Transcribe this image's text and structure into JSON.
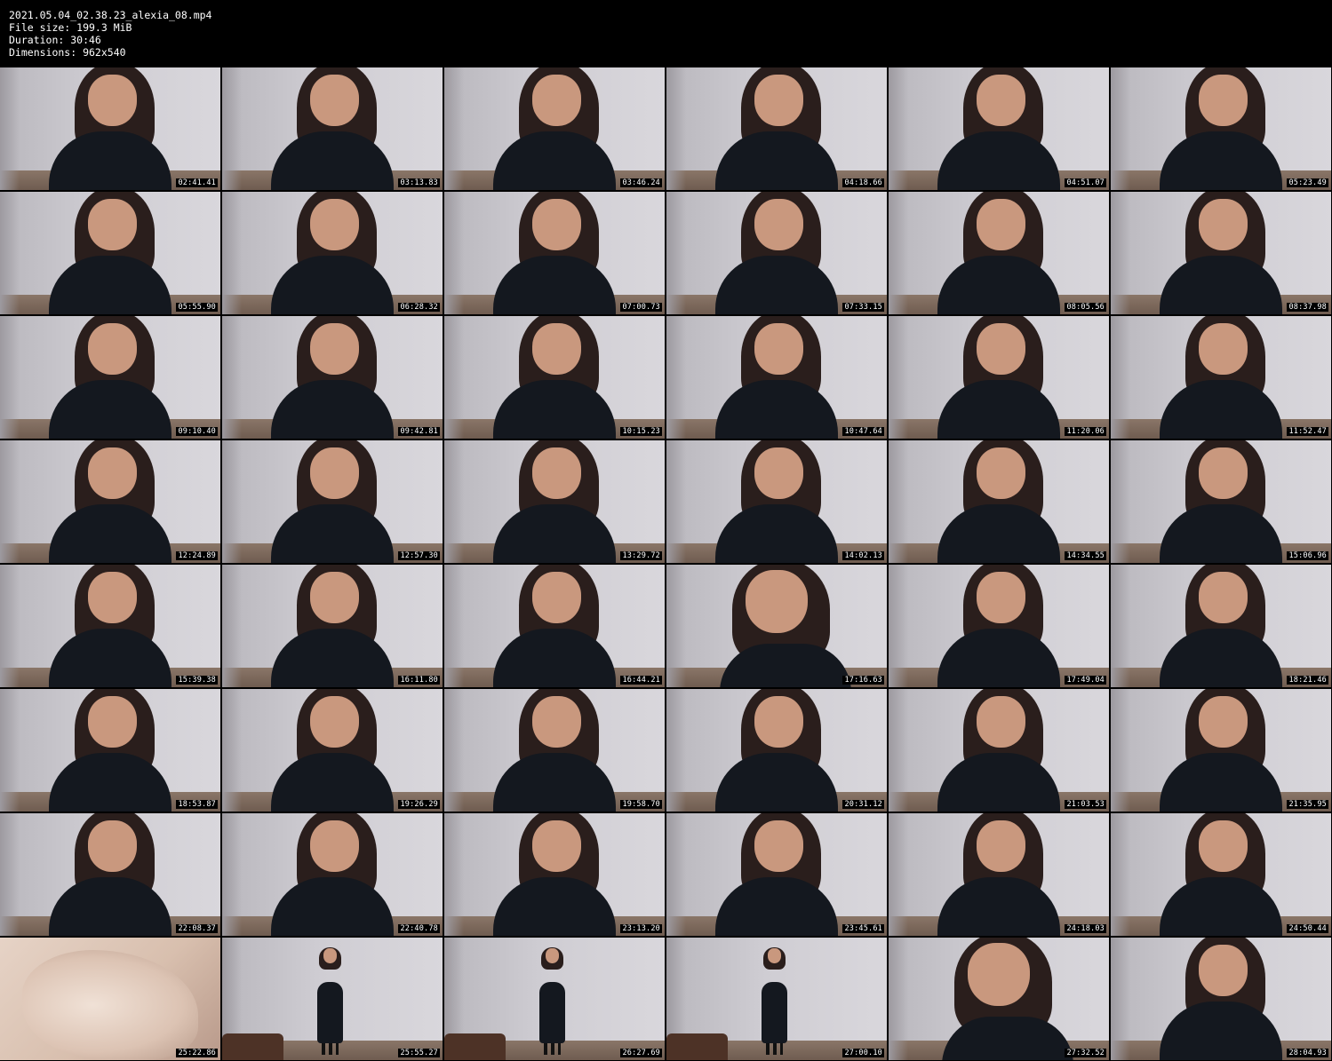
{
  "header": {
    "filename": "2021.05.04_02.38.23_alexia_08.mp4",
    "file_size": "File size: 199.3 MiB",
    "duration": "Duration: 30:46",
    "dimensions": "Dimensions: 962x540"
  },
  "thumbnails": [
    {
      "timestamp": "02:41.41",
      "kind": "portrait"
    },
    {
      "timestamp": "03:13.83",
      "kind": "portrait"
    },
    {
      "timestamp": "03:46.24",
      "kind": "portrait"
    },
    {
      "timestamp": "04:18.66",
      "kind": "portrait"
    },
    {
      "timestamp": "04:51.07",
      "kind": "portrait"
    },
    {
      "timestamp": "05:23.49",
      "kind": "portrait"
    },
    {
      "timestamp": "05:55.90",
      "kind": "portrait"
    },
    {
      "timestamp": "06:28.32",
      "kind": "portrait"
    },
    {
      "timestamp": "07:00.73",
      "kind": "portrait"
    },
    {
      "timestamp": "07:33.15",
      "kind": "portrait"
    },
    {
      "timestamp": "08:05.56",
      "kind": "portrait"
    },
    {
      "timestamp": "08:37.98",
      "kind": "portrait"
    },
    {
      "timestamp": "09:10.40",
      "kind": "portrait"
    },
    {
      "timestamp": "09:42.81",
      "kind": "portrait"
    },
    {
      "timestamp": "10:15.23",
      "kind": "portrait"
    },
    {
      "timestamp": "10:47.64",
      "kind": "portrait"
    },
    {
      "timestamp": "11:20.06",
      "kind": "portrait"
    },
    {
      "timestamp": "11:52.47",
      "kind": "portrait"
    },
    {
      "timestamp": "12:24.89",
      "kind": "portrait"
    },
    {
      "timestamp": "12:57.30",
      "kind": "portrait"
    },
    {
      "timestamp": "13:29.72",
      "kind": "portrait"
    },
    {
      "timestamp": "14:02.13",
      "kind": "portrait"
    },
    {
      "timestamp": "14:34.55",
      "kind": "portrait"
    },
    {
      "timestamp": "15:06.96",
      "kind": "portrait"
    },
    {
      "timestamp": "15:39.38",
      "kind": "portrait"
    },
    {
      "timestamp": "16:11.80",
      "kind": "portrait"
    },
    {
      "timestamp": "16:44.21",
      "kind": "portrait"
    },
    {
      "timestamp": "17:16.63",
      "kind": "closeup"
    },
    {
      "timestamp": "17:49.04",
      "kind": "portrait"
    },
    {
      "timestamp": "18:21.46",
      "kind": "portrait"
    },
    {
      "timestamp": "18:53.87",
      "kind": "portrait"
    },
    {
      "timestamp": "19:26.29",
      "kind": "portrait"
    },
    {
      "timestamp": "19:58.70",
      "kind": "portrait"
    },
    {
      "timestamp": "20:31.12",
      "kind": "portrait"
    },
    {
      "timestamp": "21:03.53",
      "kind": "portrait"
    },
    {
      "timestamp": "21:35.95",
      "kind": "portrait"
    },
    {
      "timestamp": "22:08.37",
      "kind": "portrait"
    },
    {
      "timestamp": "22:40.78",
      "kind": "portrait"
    },
    {
      "timestamp": "23:13.20",
      "kind": "portrait"
    },
    {
      "timestamp": "23:45.61",
      "kind": "portrait"
    },
    {
      "timestamp": "24:18.03",
      "kind": "portrait"
    },
    {
      "timestamp": "24:50.44",
      "kind": "portrait"
    },
    {
      "timestamp": "25:22.86",
      "kind": "hand"
    },
    {
      "timestamp": "25:55.27",
      "kind": "full"
    },
    {
      "timestamp": "26:27.69",
      "kind": "full"
    },
    {
      "timestamp": "27:00.10",
      "kind": "full"
    },
    {
      "timestamp": "27:32.52",
      "kind": "closeup"
    },
    {
      "timestamp": "28:04.93",
      "kind": "portrait"
    }
  ]
}
